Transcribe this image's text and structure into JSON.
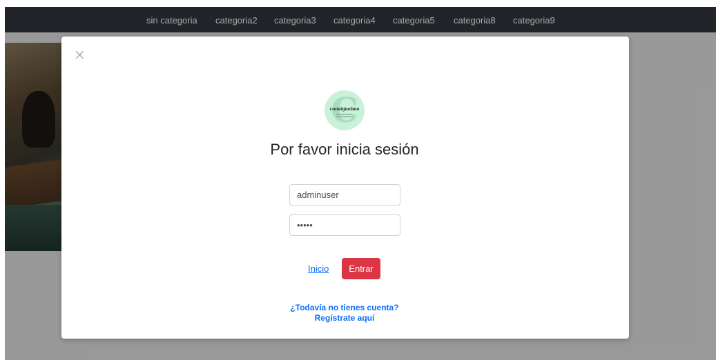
{
  "navbar": {
    "items": [
      {
        "label": "sin categoria"
      },
      {
        "label": "categoria2"
      },
      {
        "label": "categoria3"
      },
      {
        "label": "categoria4"
      },
      {
        "label": "categoria5"
      },
      {
        "label": "categoria8"
      },
      {
        "label": "categoria9"
      }
    ]
  },
  "modal": {
    "close_icon": "close-icon",
    "close_glyph": "×",
    "logo": {
      "letter": "C",
      "text": "consignelmo"
    },
    "title": "Por favor inicia sesión",
    "username_value": "adminuser",
    "password_value": "•••••",
    "inicio_label": "Inicio",
    "submit_label": "Entrar",
    "register_line1": "¿Todavía no tienes cuenta?",
    "register_line2": "Regístrate aquí"
  },
  "colors": {
    "navbar_bg": "#343a40",
    "button_red": "#dc3545",
    "link_blue": "#0d6efd",
    "logo_green": "#c9f1d8"
  }
}
